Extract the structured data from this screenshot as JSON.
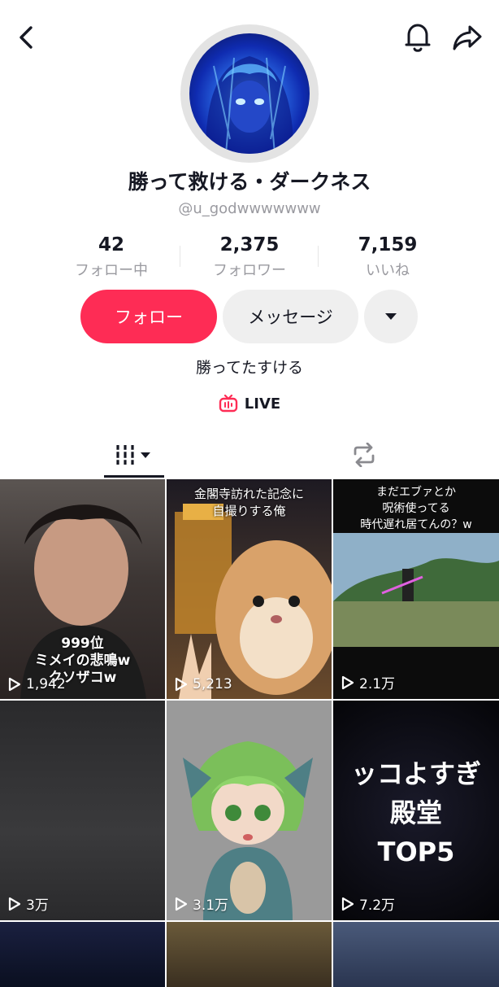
{
  "header": {
    "back_icon": "chevron-left-icon",
    "bell_icon": "bell-icon",
    "share_icon": "share-arrow-icon"
  },
  "profile": {
    "name": "勝って救ける・ダークネス",
    "handle": "@u_godwwwwwww",
    "bio": "勝ってたすける",
    "live_label": "LIVE"
  },
  "stats": [
    {
      "value": "42",
      "label": "フォロー中"
    },
    {
      "value": "2,375",
      "label": "フォロワー"
    },
    {
      "value": "7,159",
      "label": "いいね"
    }
  ],
  "actions": {
    "follow": "フォロー",
    "message": "メッセージ"
  },
  "colors": {
    "accent": "#fe2c55",
    "secondary_btn": "#efefef"
  },
  "videos": [
    {
      "views": "1,942",
      "caption": "999位\nミメイの悲鳴w\nクソザコw"
    },
    {
      "views": "5,213",
      "caption": "金閣寺訪れた記念に\n自撮りする俺"
    },
    {
      "views": "2.1万",
      "caption": "まだエブァとか\n呪術使ってる\n時代遅れ居てんの？w"
    },
    {
      "views": "3万",
      "caption": ""
    },
    {
      "views": "3.1万",
      "caption": ""
    },
    {
      "views": "7.2万",
      "caption": "ッコよすぎ\n殿堂\nTOP5"
    }
  ]
}
